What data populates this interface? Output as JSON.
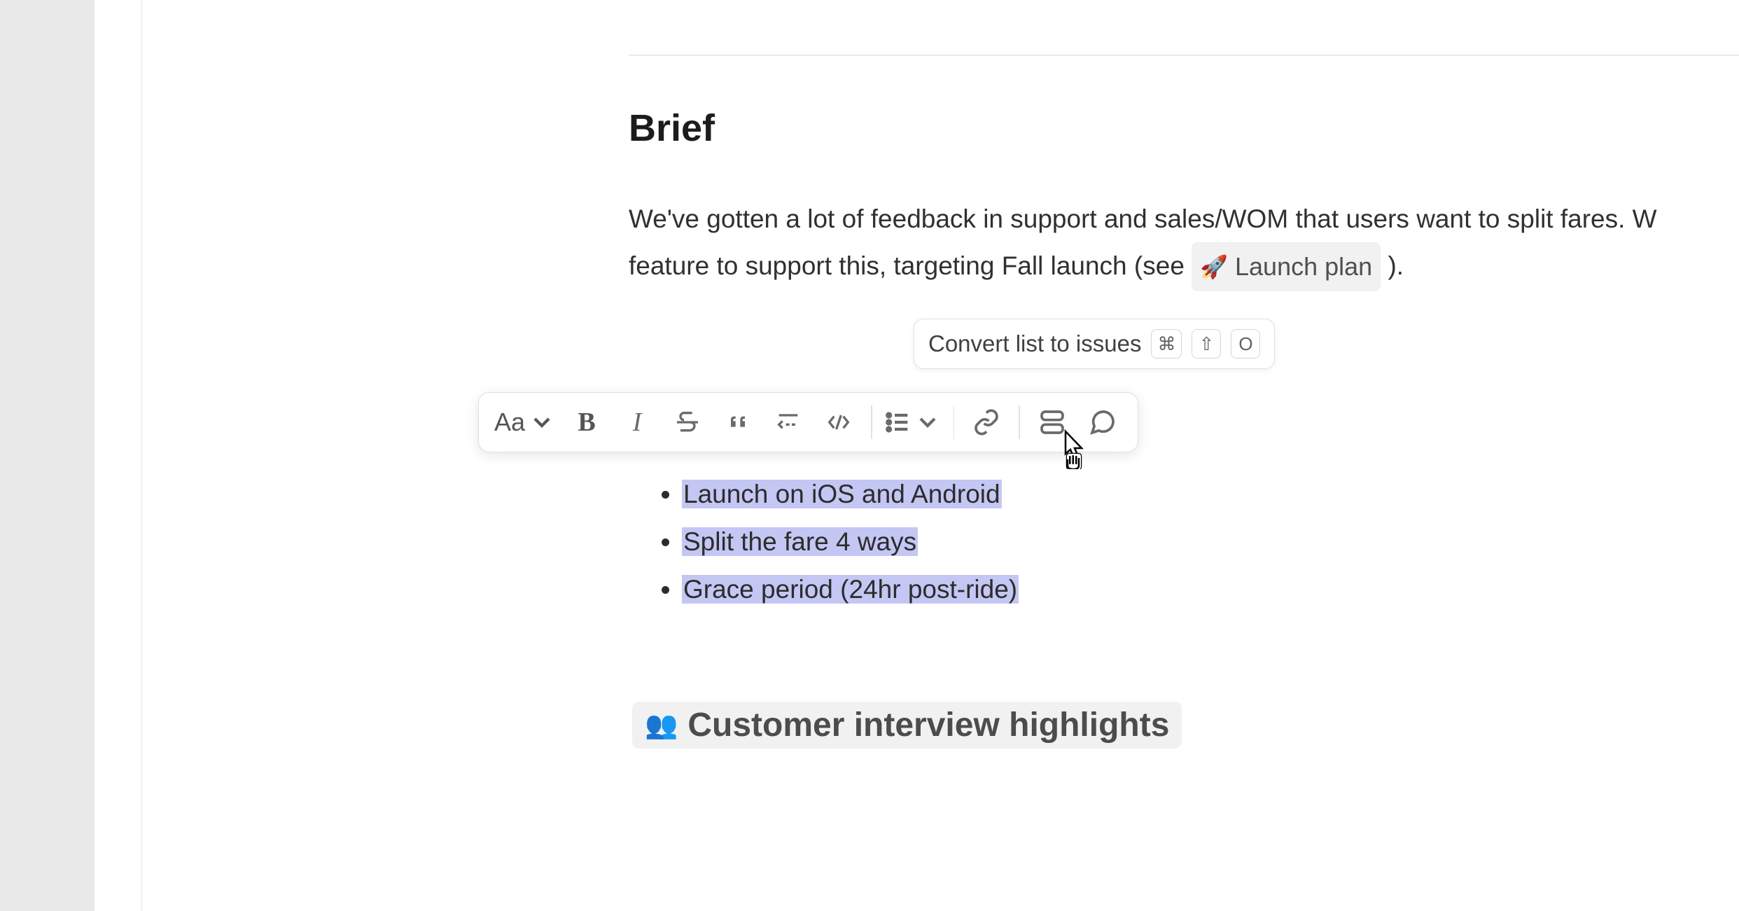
{
  "heading": "Brief",
  "paragraph": {
    "text_before": "We've gotten a lot of feedback in support and sales/WOM that users want to split fares. W",
    "text_line2_before": "feature to support this, targeting Fall launch (see ",
    "link_emoji": "🚀",
    "link_text": "Launch plan",
    "text_after": " )."
  },
  "tooltip": {
    "text": "Convert list to issues",
    "keys": [
      "⌘",
      "⇧",
      "O"
    ]
  },
  "toolbar": {
    "text_style": "Aa"
  },
  "bullets": [
    "Launch on iOS and Android",
    "Split the fare 4 ways",
    "Grace period (24hr post-ride)"
  ],
  "subheading": {
    "emoji": "👥",
    "text": "Customer interview highlights"
  }
}
